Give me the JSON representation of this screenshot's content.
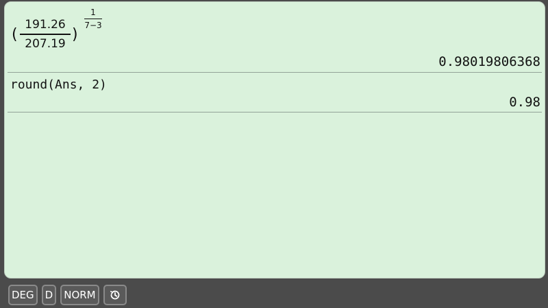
{
  "history": [
    {
      "expression": {
        "open_paren": "(",
        "numerator": "191.26",
        "denominator": "207.19",
        "close_paren": ")",
        "exponent_numerator": "1",
        "exponent_denominator": "7−3"
      },
      "result": "0.98019806368"
    },
    {
      "expression_text": "round(Ans, 2)",
      "result": "0.98"
    }
  ],
  "toolbar": {
    "angle_mode": "DEG",
    "display_mode": "D",
    "number_format": "NORM",
    "history_icon": "history-icon"
  },
  "colors": {
    "screen_bg": "#daf2dc",
    "frame_bg": "#4b4b4b",
    "divider": "#93a397"
  }
}
